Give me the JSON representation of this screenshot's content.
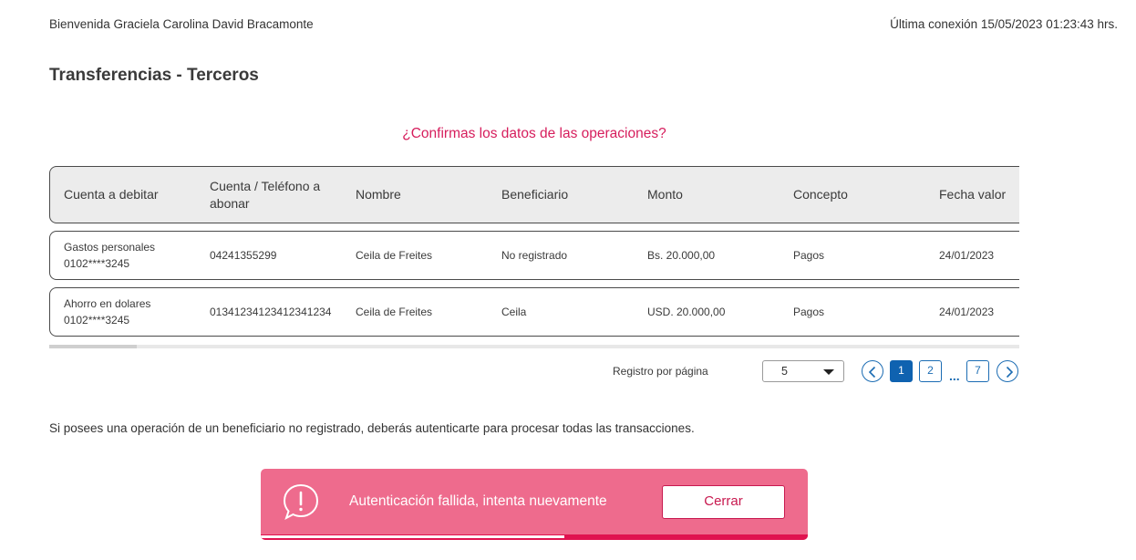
{
  "header": {
    "welcome": "Bienvenida Graciela Carolina David Bracamonte",
    "last_connection": "Última conexión 15/05/2023 01:23:43 hrs."
  },
  "page_title": "Transferencias - Terceros",
  "confirm_question": "¿Confirmas los datos de las operaciones?",
  "table": {
    "columns": [
      "Cuenta a debitar",
      "Cuenta / Teléfono a abonar",
      "Nombre",
      "Beneficiario",
      "Monto",
      "Concepto",
      "Fecha valor"
    ],
    "rows": [
      {
        "account_name": "Gastos personales",
        "account_number": "0102****3245",
        "destination": "04241355299",
        "name": "Ceila de Freites",
        "beneficiary": "No registrado",
        "amount": "Bs. 20.000,00",
        "concept": "Pagos",
        "date": "24/01/2023"
      },
      {
        "account_name": "Ahorro en dolares",
        "account_number": "0102****3245",
        "destination": "01341234123412341234",
        "name": "Ceila de Freites",
        "beneficiary": "Ceila",
        "amount": "USD. 20.000,00",
        "concept": "Pagos",
        "date": "24/01/2023"
      }
    ]
  },
  "pagination": {
    "rows_per_page_label": "Registro por página",
    "rows_per_page_value": "5",
    "pages": [
      "1",
      "2",
      "7"
    ],
    "ellipsis": "...",
    "current_page": "1"
  },
  "notice": "Si posees una operación de un beneficiario no registrado, deberás autenticarte para procesar todas las transacciones.",
  "toast": {
    "message": "Autenticación fallida, intenta nuevamente",
    "close_label": "Cerrar",
    "icon": "alert-icon",
    "progress_remaining": 0.555
  },
  "colors": {
    "accent": "#d61d5c",
    "toast_bg": "#ee6b8d",
    "link_blue": "#1b6cb3"
  }
}
